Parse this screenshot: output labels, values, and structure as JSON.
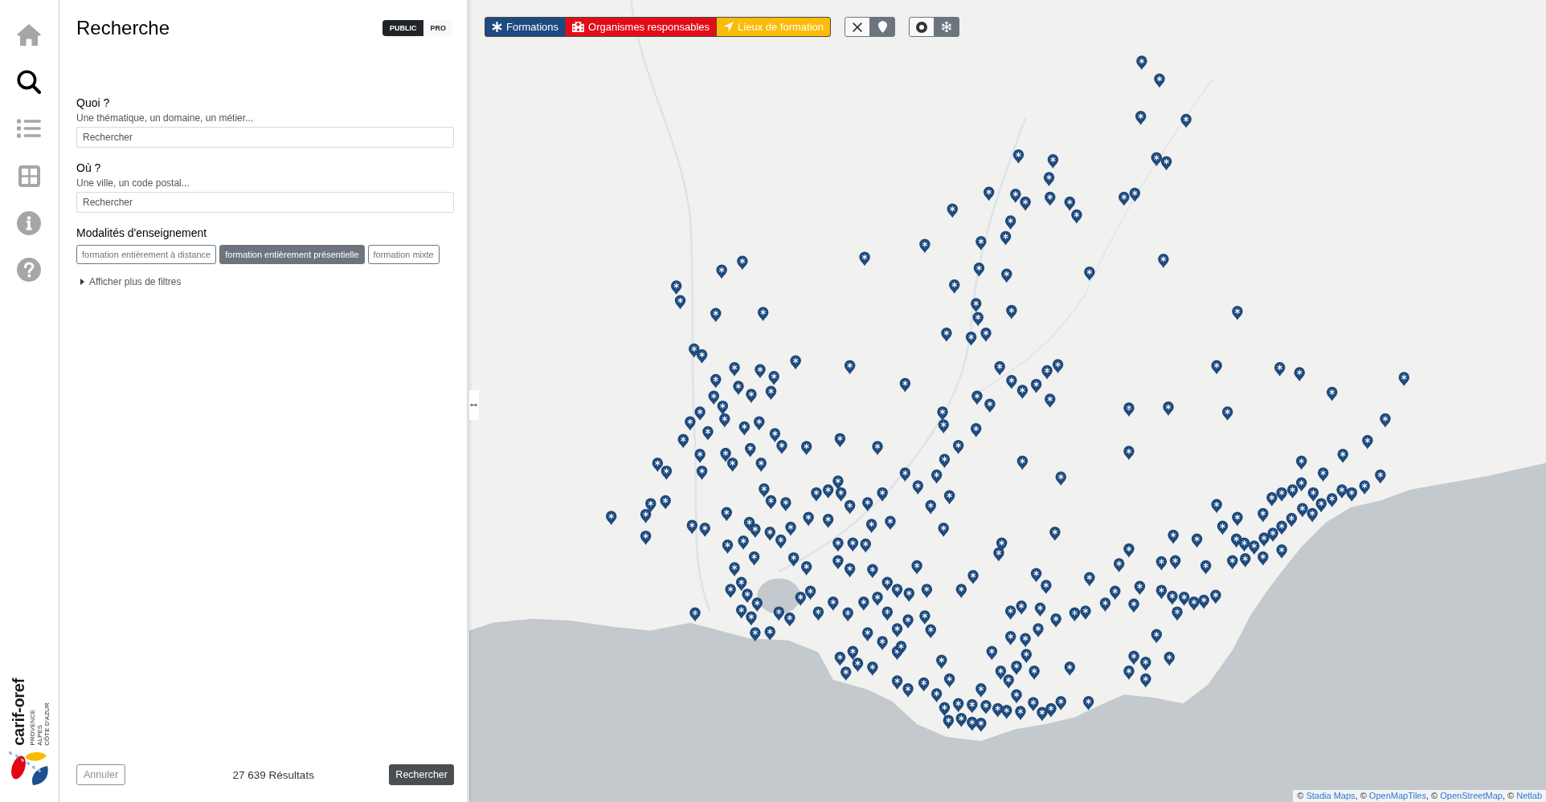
{
  "sidebar": {
    "items": [
      {
        "selected": false
      },
      {
        "selected": true
      },
      {
        "selected": false
      },
      {
        "selected": false
      },
      {
        "selected": false
      },
      {
        "selected": false
      }
    ],
    "logo": {
      "name": "carif-oref",
      "region_lines": [
        "PROVENCE",
        "ALPES",
        "CÔTE D'AZUR"
      ]
    }
  },
  "panel": {
    "title": "Recherche",
    "audience_toggle": [
      {
        "label": "PUBLIC",
        "selected": true
      },
      {
        "label": "PRO",
        "selected": false
      }
    ],
    "fields": [
      {
        "label": "Quoi ?",
        "hint": "Une thématique, un domaine, un métier...",
        "placeholder": "Rechercher"
      },
      {
        "label": "Où ?",
        "hint": "Une ville, un code postal...",
        "placeholder": "Rechercher"
      }
    ],
    "modalities": {
      "label": "Modalités d'enseignement",
      "options": [
        {
          "label": "formation entièrement à distance",
          "selected": false
        },
        {
          "label": "formation entièrement présentielle",
          "selected": true
        },
        {
          "label": "formation mixte",
          "selected": false
        }
      ]
    },
    "more_filters": {
      "label": "Afficher plus de filtres",
      "expanded": false
    },
    "footer": {
      "cancel": "Annuler",
      "results": "27 639 Résultats",
      "submit": "Rechercher"
    }
  },
  "map": {
    "layers": [
      {
        "label": "Formations",
        "color": "#1d4a80"
      },
      {
        "label": "Organismes responsables",
        "color": "#e30d18"
      },
      {
        "label": "Lieux de formation",
        "color": "#fbbb06"
      }
    ],
    "tool_groups": [
      {
        "buttons": [
          {
            "selected": false
          },
          {
            "selected": true
          }
        ]
      },
      {
        "buttons": [
          {
            "selected": false
          },
          {
            "selected": true
          }
        ]
      }
    ],
    "attribution": [
      {
        "kind": "text",
        "text": "© "
      },
      {
        "kind": "link",
        "text": "Stadia Maps"
      },
      {
        "kind": "text",
        "text": ", © "
      },
      {
        "kind": "link",
        "text": "OpenMapTiles"
      },
      {
        "kind": "text",
        "text": ", © "
      },
      {
        "kind": "link",
        "text": "OpenStreetMap"
      },
      {
        "kind": "text",
        "text": ", © "
      },
      {
        "kind": "link",
        "text": "Netlab"
      }
    ]
  }
}
